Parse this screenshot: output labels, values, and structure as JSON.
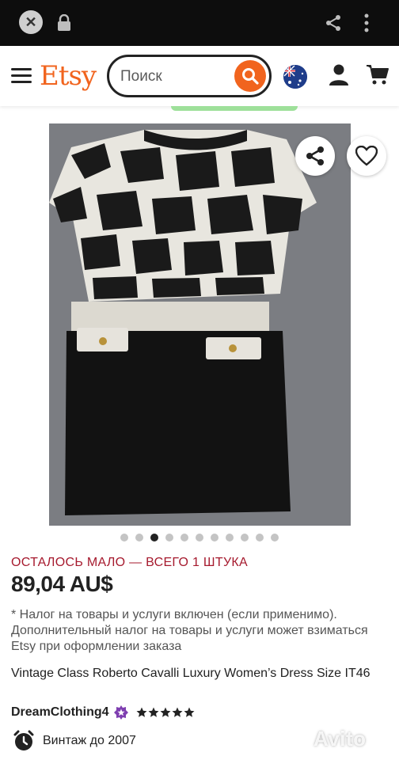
{
  "browser": {
    "close_icon": "close-icon",
    "lock_icon": "lock-icon",
    "share_icon": "share-icon",
    "menu_icon": "kebab-menu-icon"
  },
  "header": {
    "logo": "Etsy",
    "search_placeholder": "Поиск",
    "flag": "australia-flag",
    "accent_color": "#f1641e"
  },
  "listing": {
    "stock_text": "ОСТАЛОСЬ МАЛО — ВСЕГО 1 ШТУКА",
    "price": "89,04 AU$",
    "tax_note": "* Налог на товары и услуги включен (если применимо). Дополнительный налог на товары и услуги может взиматься Etsy при оформлении заказа",
    "title": "Vintage Class Roberto Cavalli Luxury Women’s Dress Size IT46",
    "shop_name": "DreamClothing4",
    "rating_stars": 5,
    "vintage_label": "Винтаж до 2007",
    "image_count": 11,
    "active_image": 3
  },
  "watermark": "Avito"
}
